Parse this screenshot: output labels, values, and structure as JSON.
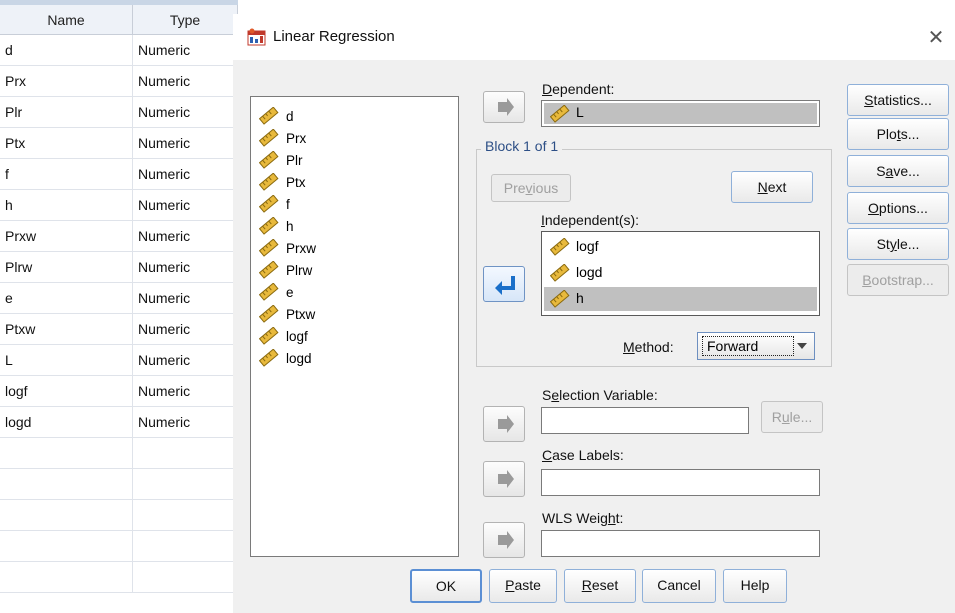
{
  "grid": {
    "headers": [
      "Name",
      "Type"
    ],
    "rows": [
      [
        "d",
        "Numeric"
      ],
      [
        "Prx",
        "Numeric"
      ],
      [
        "Plr",
        "Numeric"
      ],
      [
        "Ptx",
        "Numeric"
      ],
      [
        "f",
        "Numeric"
      ],
      [
        "h",
        "Numeric"
      ],
      [
        "Prxw",
        "Numeric"
      ],
      [
        "Plrw",
        "Numeric"
      ],
      [
        "e",
        "Numeric"
      ],
      [
        "Ptxw",
        "Numeric"
      ],
      [
        "L",
        "Numeric"
      ],
      [
        "logf",
        "Numeric"
      ],
      [
        "logd",
        "Numeric"
      ]
    ]
  },
  "dialog": {
    "title": "Linear Regression",
    "close_icon": "close-icon",
    "variables": [
      "d",
      "Prx",
      "Plr",
      "Ptx",
      "f",
      "h",
      "Prxw",
      "Plrw",
      "e",
      "Ptxw",
      "logf",
      "logd"
    ],
    "dependent": {
      "label": "Dependent:",
      "value": "L"
    },
    "block": {
      "label": "Block 1 of 1",
      "previous": "Previous",
      "next": "Next",
      "independents_label": "Independent(s):",
      "independents": [
        "logf",
        "logd",
        "h"
      ],
      "selected_independent": "h",
      "method_label": "Method:",
      "method_value": "Forward"
    },
    "selection_variable": {
      "label": "Selection Variable:",
      "value": "",
      "rule_button": "Rule..."
    },
    "case_labels": {
      "label": "Case Labels:",
      "value": ""
    },
    "wls_weight": {
      "label": "WLS Weight:",
      "value": ""
    },
    "side_buttons": [
      "Statistics...",
      "Plots...",
      "Save...",
      "Options...",
      "Style...",
      "Bootstrap..."
    ],
    "bottom_buttons": [
      "OK",
      "Paste",
      "Reset",
      "Cancel",
      "Help"
    ],
    "colors": {
      "selection": "#c0c0c0",
      "accent_border": "#8fb0d9",
      "arrow_active": "#1a6fc9"
    }
  }
}
